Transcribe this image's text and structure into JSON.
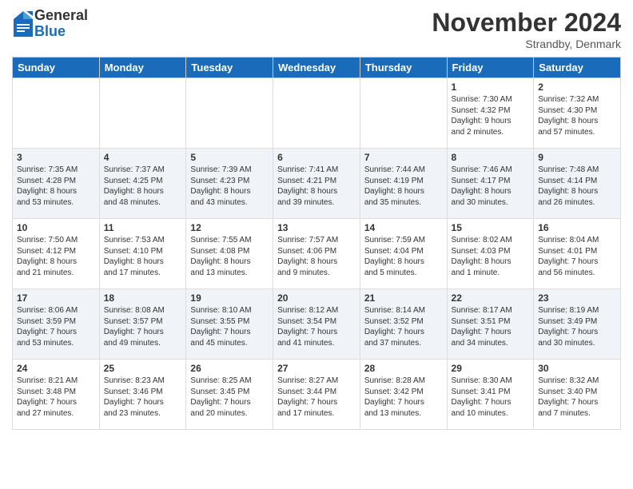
{
  "header": {
    "logo_general": "General",
    "logo_blue": "Blue",
    "month_title": "November 2024",
    "location": "Strandby, Denmark"
  },
  "days_of_week": [
    "Sunday",
    "Monday",
    "Tuesday",
    "Wednesday",
    "Thursday",
    "Friday",
    "Saturday"
  ],
  "weeks": [
    [
      {
        "day": "",
        "detail": ""
      },
      {
        "day": "",
        "detail": ""
      },
      {
        "day": "",
        "detail": ""
      },
      {
        "day": "",
        "detail": ""
      },
      {
        "day": "",
        "detail": ""
      },
      {
        "day": "1",
        "detail": "Sunrise: 7:30 AM\nSunset: 4:32 PM\nDaylight: 9 hours\nand 2 minutes."
      },
      {
        "day": "2",
        "detail": "Sunrise: 7:32 AM\nSunset: 4:30 PM\nDaylight: 8 hours\nand 57 minutes."
      }
    ],
    [
      {
        "day": "3",
        "detail": "Sunrise: 7:35 AM\nSunset: 4:28 PM\nDaylight: 8 hours\nand 53 minutes."
      },
      {
        "day": "4",
        "detail": "Sunrise: 7:37 AM\nSunset: 4:25 PM\nDaylight: 8 hours\nand 48 minutes."
      },
      {
        "day": "5",
        "detail": "Sunrise: 7:39 AM\nSunset: 4:23 PM\nDaylight: 8 hours\nand 43 minutes."
      },
      {
        "day": "6",
        "detail": "Sunrise: 7:41 AM\nSunset: 4:21 PM\nDaylight: 8 hours\nand 39 minutes."
      },
      {
        "day": "7",
        "detail": "Sunrise: 7:44 AM\nSunset: 4:19 PM\nDaylight: 8 hours\nand 35 minutes."
      },
      {
        "day": "8",
        "detail": "Sunrise: 7:46 AM\nSunset: 4:17 PM\nDaylight: 8 hours\nand 30 minutes."
      },
      {
        "day": "9",
        "detail": "Sunrise: 7:48 AM\nSunset: 4:14 PM\nDaylight: 8 hours\nand 26 minutes."
      }
    ],
    [
      {
        "day": "10",
        "detail": "Sunrise: 7:50 AM\nSunset: 4:12 PM\nDaylight: 8 hours\nand 21 minutes."
      },
      {
        "day": "11",
        "detail": "Sunrise: 7:53 AM\nSunset: 4:10 PM\nDaylight: 8 hours\nand 17 minutes."
      },
      {
        "day": "12",
        "detail": "Sunrise: 7:55 AM\nSunset: 4:08 PM\nDaylight: 8 hours\nand 13 minutes."
      },
      {
        "day": "13",
        "detail": "Sunrise: 7:57 AM\nSunset: 4:06 PM\nDaylight: 8 hours\nand 9 minutes."
      },
      {
        "day": "14",
        "detail": "Sunrise: 7:59 AM\nSunset: 4:04 PM\nDaylight: 8 hours\nand 5 minutes."
      },
      {
        "day": "15",
        "detail": "Sunrise: 8:02 AM\nSunset: 4:03 PM\nDaylight: 8 hours\nand 1 minute."
      },
      {
        "day": "16",
        "detail": "Sunrise: 8:04 AM\nSunset: 4:01 PM\nDaylight: 7 hours\nand 56 minutes."
      }
    ],
    [
      {
        "day": "17",
        "detail": "Sunrise: 8:06 AM\nSunset: 3:59 PM\nDaylight: 7 hours\nand 53 minutes."
      },
      {
        "day": "18",
        "detail": "Sunrise: 8:08 AM\nSunset: 3:57 PM\nDaylight: 7 hours\nand 49 minutes."
      },
      {
        "day": "19",
        "detail": "Sunrise: 8:10 AM\nSunset: 3:55 PM\nDaylight: 7 hours\nand 45 minutes."
      },
      {
        "day": "20",
        "detail": "Sunrise: 8:12 AM\nSunset: 3:54 PM\nDaylight: 7 hours\nand 41 minutes."
      },
      {
        "day": "21",
        "detail": "Sunrise: 8:14 AM\nSunset: 3:52 PM\nDaylight: 7 hours\nand 37 minutes."
      },
      {
        "day": "22",
        "detail": "Sunrise: 8:17 AM\nSunset: 3:51 PM\nDaylight: 7 hours\nand 34 minutes."
      },
      {
        "day": "23",
        "detail": "Sunrise: 8:19 AM\nSunset: 3:49 PM\nDaylight: 7 hours\nand 30 minutes."
      }
    ],
    [
      {
        "day": "24",
        "detail": "Sunrise: 8:21 AM\nSunset: 3:48 PM\nDaylight: 7 hours\nand 27 minutes."
      },
      {
        "day": "25",
        "detail": "Sunrise: 8:23 AM\nSunset: 3:46 PM\nDaylight: 7 hours\nand 23 minutes."
      },
      {
        "day": "26",
        "detail": "Sunrise: 8:25 AM\nSunset: 3:45 PM\nDaylight: 7 hours\nand 20 minutes."
      },
      {
        "day": "27",
        "detail": "Sunrise: 8:27 AM\nSunset: 3:44 PM\nDaylight: 7 hours\nand 17 minutes."
      },
      {
        "day": "28",
        "detail": "Sunrise: 8:28 AM\nSunset: 3:42 PM\nDaylight: 7 hours\nand 13 minutes."
      },
      {
        "day": "29",
        "detail": "Sunrise: 8:30 AM\nSunset: 3:41 PM\nDaylight: 7 hours\nand 10 minutes."
      },
      {
        "day": "30",
        "detail": "Sunrise: 8:32 AM\nSunset: 3:40 PM\nDaylight: 7 hours\nand 7 minutes."
      }
    ]
  ]
}
